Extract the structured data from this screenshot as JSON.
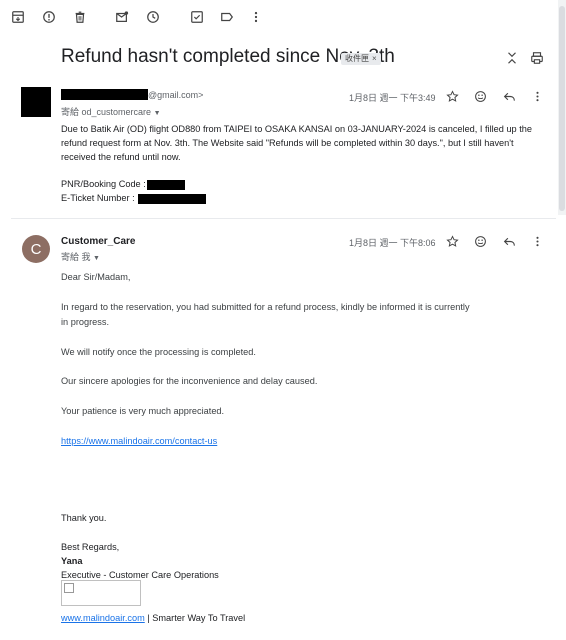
{
  "subject": "Refund hasn't completed since Nov. 3th",
  "label_chip": "收件匣",
  "label_chip_close": "×",
  "message1": {
    "sender_email_suffix": "@gmail.com>",
    "to_line": "寄給 od_customercare",
    "date": "1月8日 週一 下午3:49",
    "body": "Due to Batik Air (OD) flight OD880 from TAIPEI to OSAKA KANSAI on 03-JANUARY-2024 is canceled, I filled up the refund request form at Nov. 3th. The Website said \"Refunds will be completed within 30 days.\", but I still haven't received the refund until now.",
    "pnr_label": "PNR/Booking Code :",
    "eticket_label": "E-Ticket Number :"
  },
  "message2": {
    "avatar_letter": "C",
    "sender_name": "Customer_Care",
    "to_line": "寄給 我",
    "date": "1月8日 週一 下午8:06",
    "greeting": "Dear Sir/Madam,",
    "p1_line1": "In regard to the reservation, you had submitted for a refund process, kindly be informed it is currently",
    "p1_line2": "in progress.",
    "p2": "We will notify once the processing is completed.",
    "p3": "Our sincere apologies for the inconvenience and delay caused.",
    "p4": "Your patience is very much appreciated.",
    "contact_link": "https://www.malindoair.com/contact-us",
    "thank_you": "Thank you.",
    "best_regards": "Best Regards,",
    "signer": "Yana",
    "signer_title": "Executive - Customer Care Operations",
    "website_link": "www.malindoair.com",
    "tagline": " | Smarter Way To Travel"
  }
}
